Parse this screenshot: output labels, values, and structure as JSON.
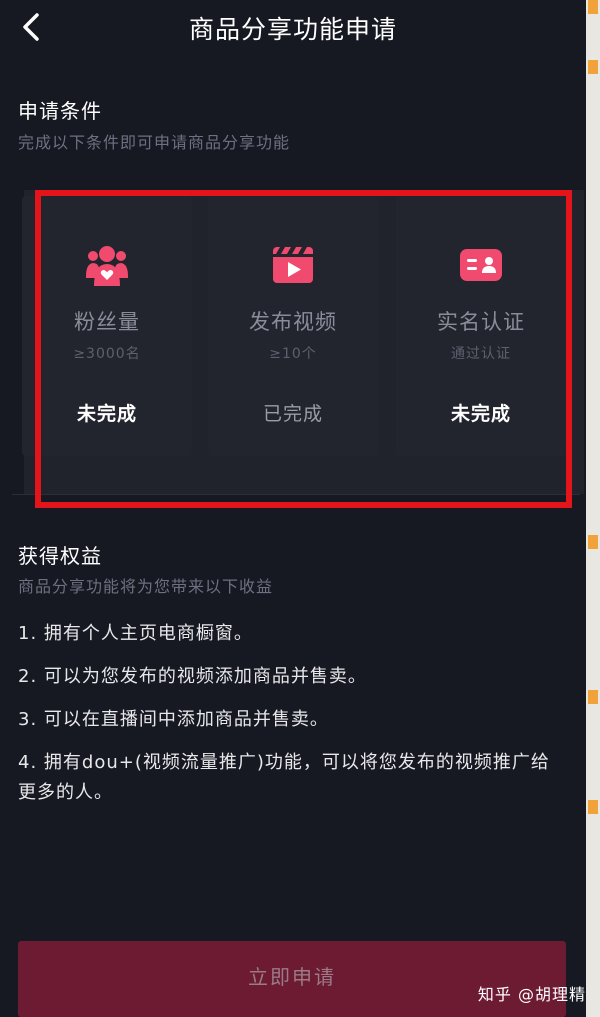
{
  "header": {
    "title": "商品分享功能申请"
  },
  "conditions": {
    "title": "申请条件",
    "subtitle": "完成以下条件即可申请商品分享功能",
    "cards": [
      {
        "title": "粉丝量",
        "requirement": "≥3000名",
        "status": "未完成",
        "icon": "fans-icon"
      },
      {
        "title": "发布视频",
        "requirement": "≥10个",
        "status": "已完成",
        "icon": "video-icon"
      },
      {
        "title": "实名认证",
        "requirement": "通过认证",
        "status": "未完成",
        "icon": "id-card-icon"
      }
    ]
  },
  "benefits": {
    "title": "获得权益",
    "subtitle": "商品分享功能将为您带来以下收益",
    "items": [
      "1. 拥有个人主页电商橱窗。",
      "2. 可以为您发布的视频添加商品并售卖。",
      "3. 可以在直播间中添加商品并售卖。",
      "4. 拥有dou+(视频流量推广)功能，可以将您发布的视频推广给更多的人。"
    ]
  },
  "apply_button": {
    "label": "立即申请"
  },
  "watermark": "知乎 @胡理精",
  "colors": {
    "background": "#161822",
    "accent_pink": "#f04a6e",
    "highlight_frame": "#e3151b",
    "button": "#6d1a33"
  }
}
